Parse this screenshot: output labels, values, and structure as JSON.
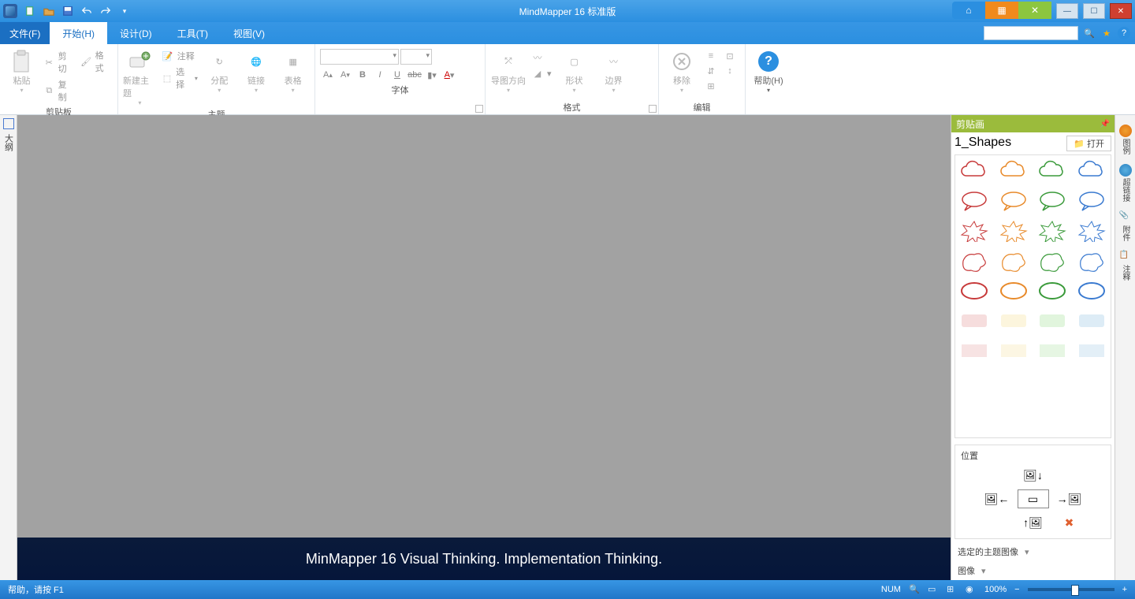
{
  "titlebar": {
    "app_title": "MindMapper 16 标准版"
  },
  "menubar": {
    "file": "文件(F)",
    "tabs": [
      {
        "label": "开始(H)",
        "active": true
      },
      {
        "label": "设计(D)"
      },
      {
        "label": "工具(T)"
      },
      {
        "label": "视图(V)"
      }
    ]
  },
  "ribbon": {
    "clipboard": {
      "paste": "粘贴",
      "cut": "剪切",
      "copy": "复制",
      "format": "格式",
      "group_label": "剪贴板"
    },
    "topic": {
      "new_topic": "新建主题",
      "annotation": "注释",
      "select": "选择",
      "assign": "分配",
      "link": "链接",
      "table": "表格",
      "group_label": "主题"
    },
    "font": {
      "group_label": "字体"
    },
    "format": {
      "diagram_dir": "导图方向",
      "shape": "形状",
      "boundary": "边界",
      "group_label": "格式"
    },
    "edit": {
      "remove": "移除",
      "group_label": "编辑"
    },
    "help": {
      "help": "帮助(H)"
    }
  },
  "left_strip": {
    "outline": "大纲"
  },
  "right_panel": {
    "title": "剪贴画",
    "shapes_category": "1_Shapes",
    "open": "打开",
    "position": "位置",
    "selected_topic_image": "选定的主题图像",
    "image": "图像"
  },
  "right_strip": {
    "legend": "图例",
    "hyperlink": "超链接",
    "attachment": "附件",
    "note": "注释"
  },
  "watermark": "MinMapper 16 Visual Thinking. Implementation Thinking.",
  "statusbar": {
    "help": "帮助，请按 F1",
    "num": "NUM",
    "zoom": "100%"
  },
  "shape_rows": [
    [
      "#c73a3a",
      "#e88a2a",
      "#3a9a3a",
      "#3a7ad0"
    ],
    [
      "#c73a3a",
      "#e88a2a",
      "#3a9a3a",
      "#3a7ad0"
    ],
    [
      "#c73a3a",
      "#e88a2a",
      "#3a9a3a",
      "#3a7ad0"
    ],
    [
      "#c73a3a",
      "#e88a2a",
      "#3a9a3a",
      "#3a7ad0"
    ],
    [
      "#c73a3a",
      "#e88a2a",
      "#3a9a3a",
      "#3a7ad0"
    ],
    [
      "#f0c7c7",
      "#faeec7",
      "#cdeec7",
      "#c7e0f0"
    ],
    [
      "#f0c7c7",
      "#faeec7",
      "#cdeec7",
      "#c7e0f0"
    ]
  ]
}
